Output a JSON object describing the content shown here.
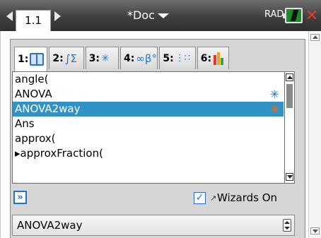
{
  "topbar": {
    "page_tab": "1.1",
    "doc_title": "*Doc",
    "mode": "RAD"
  },
  "catalog": {
    "tabs": [
      {
        "label": "1:",
        "icon": "book-icon"
      },
      {
        "label": "2:",
        "icon": "integral-icon",
        "glyph": "∫Σ"
      },
      {
        "label": "3:",
        "icon": "scatter-icon"
      },
      {
        "label": "4:",
        "icon": "infinity-beta-icon",
        "glyph": "∞β°"
      },
      {
        "label": "5:",
        "icon": "matrix-icon",
        "glyph": "⋮∷"
      },
      {
        "label": "6:",
        "icon": "bar-chart-icon"
      }
    ],
    "items": [
      {
        "label": "angle(",
        "wizard": false
      },
      {
        "label": "ANOVA",
        "wizard": true
      },
      {
        "label": "ANOVA2way",
        "wizard": true,
        "selected": true
      },
      {
        "label": "Ans",
        "wizard": false
      },
      {
        "label": "approx(",
        "wizard": false
      },
      {
        "label": "▸approxFraction(",
        "wizard": false
      }
    ],
    "wizard_glyph": "✳",
    "help_glyph": "»",
    "wizards_checked": true,
    "check_glyph": "✓",
    "wizards_icon_glyph": "↗",
    "wizards_label": "Wizards On",
    "selected_value": "ANOVA2way"
  },
  "colors": {
    "selection": "#2f93c8",
    "accent": "#1b78c9",
    "close": "#e33a2a"
  }
}
